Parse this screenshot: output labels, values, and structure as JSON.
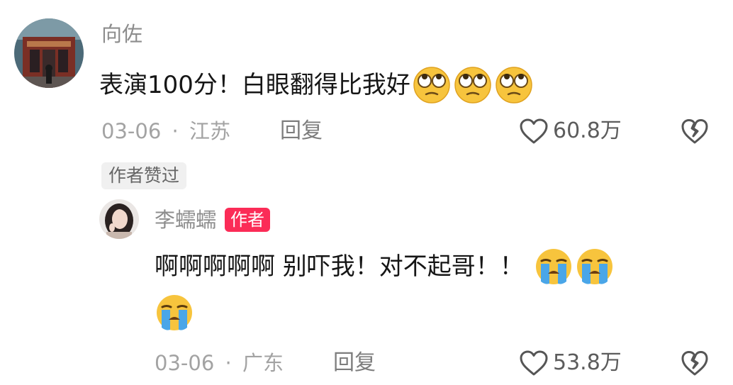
{
  "comment": {
    "username": "向佐",
    "text": "表演100分！白眼翻得比我好",
    "emojis": [
      "eye-roll-emoji",
      "eye-roll-emoji",
      "eye-roll-emoji"
    ],
    "date": "03-06",
    "separator": "·",
    "location": "江苏",
    "reply_label": "回复",
    "likes": "60.8万",
    "liked_badge": "作者赞过"
  },
  "reply": {
    "username": "李蠕蠕",
    "author_tag": "作者",
    "text": "啊啊啊啊啊 别吓我！对不起哥！！",
    "emojis": [
      "crying-emoji",
      "crying-emoji",
      "crying-emoji"
    ],
    "date": "03-06",
    "separator": "·",
    "location": "广东",
    "reply_label": "回复",
    "likes": "53.8万"
  },
  "colors": {
    "text": "#161616",
    "meta": "#a3a3a3",
    "author_tag": "#fb2c57"
  }
}
